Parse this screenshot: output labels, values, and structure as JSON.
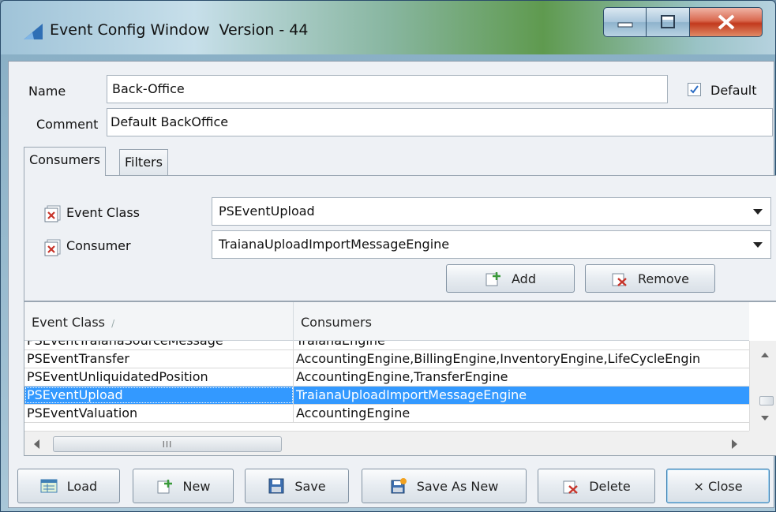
{
  "window": {
    "title": "Event Config Window  Version - 44"
  },
  "form": {
    "name_label": "Name",
    "name_value": "Back-Office",
    "comment_label": "Comment",
    "comment_value": "Default BackOffice",
    "default_label": "Default",
    "default_checked": true
  },
  "tabs": [
    {
      "label": "Consumers",
      "active": true
    },
    {
      "label": "Filters",
      "active": false
    }
  ],
  "consumers_panel": {
    "event_class_label": "Event Class",
    "event_class_value": "PSEventUpload",
    "consumer_label": "Consumer",
    "consumer_value": "TraianaUploadImportMessageEngine",
    "add_label": "Add",
    "remove_label": "Remove"
  },
  "table": {
    "columns": [
      "Event Class",
      "Consumers"
    ],
    "sort_indicator": "/",
    "rows": [
      {
        "event_class": "PSEventTraianaSourceMessage",
        "consumers": "TraianaEngine",
        "selected": false
      },
      {
        "event_class": "PSEventTransfer",
        "consumers": "AccountingEngine,BillingEngine,InventoryEngine,LifeCycleEngin",
        "selected": false
      },
      {
        "event_class": "PSEventUnliquidatedPosition",
        "consumers": "AccountingEngine,TransferEngine",
        "selected": false
      },
      {
        "event_class": "PSEventUpload",
        "consumers": "TraianaUploadImportMessageEngine",
        "selected": true
      },
      {
        "event_class": "PSEventValuation",
        "consumers": "AccountingEngine",
        "selected": false
      }
    ],
    "hscroll_grip": "III"
  },
  "footer": {
    "load_label": "Load",
    "new_label": "New",
    "save_label": "Save",
    "save_as_new_label": "Save As New",
    "delete_label": "Delete",
    "close_label": "× Close"
  },
  "colors": {
    "selection": "#3399ff",
    "close_button": "#c2391d"
  }
}
